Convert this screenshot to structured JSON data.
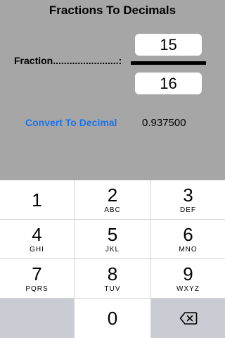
{
  "app": {
    "title": "Fractions To Decimals",
    "fraction_label": "Fraction........................:",
    "numerator": "15",
    "denominator": "16",
    "convert_label": "Convert To Decimal",
    "result": "0.937500",
    "accent_color": "#1a73e8"
  },
  "keypad": {
    "keys": [
      {
        "digit": "1",
        "letters": ""
      },
      {
        "digit": "2",
        "letters": "ABC"
      },
      {
        "digit": "3",
        "letters": "DEF"
      },
      {
        "digit": "4",
        "letters": "GHI"
      },
      {
        "digit": "5",
        "letters": "JKL"
      },
      {
        "digit": "6",
        "letters": "MNO"
      },
      {
        "digit": "7",
        "letters": "PQRS"
      },
      {
        "digit": "8",
        "letters": "TUV"
      },
      {
        "digit": "9",
        "letters": "WXYZ"
      },
      {
        "digit": "0",
        "letters": ""
      }
    ],
    "delete_icon": "backspace-icon"
  }
}
